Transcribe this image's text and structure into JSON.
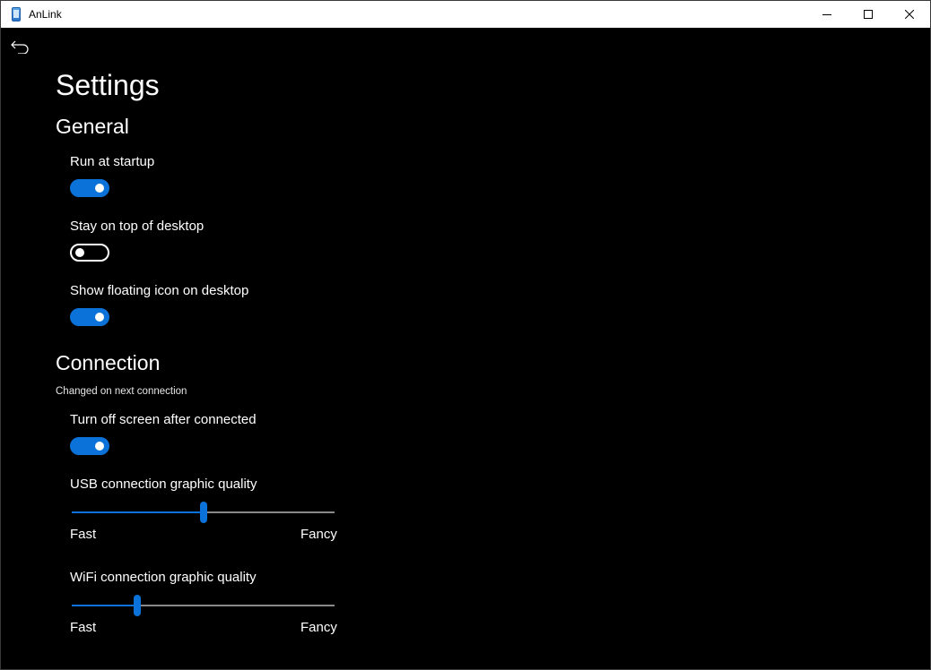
{
  "window": {
    "title": "AnLink",
    "icon": "phone-app-icon"
  },
  "page": {
    "back_icon": "back-arrow-icon",
    "title": "Settings"
  },
  "general": {
    "title": "General",
    "settings": [
      {
        "label": "Run at startup",
        "on": true
      },
      {
        "label": "Stay on top of desktop",
        "on": false
      },
      {
        "label": "Show floating icon on desktop",
        "on": true
      }
    ]
  },
  "connection": {
    "title": "Connection",
    "note": "Changed on next connection",
    "screen_off": {
      "label": "Turn off screen after connected",
      "on": true
    },
    "usb_quality": {
      "label": "USB connection graphic quality",
      "min_label": "Fast",
      "max_label": "Fancy",
      "value_percent": 50
    },
    "wifi_quality": {
      "label": "WiFi connection graphic quality",
      "min_label": "Fast",
      "max_label": "Fancy",
      "value_percent": 25
    }
  },
  "colors": {
    "accent": "#0a72d8",
    "background": "#000000",
    "titlebar": "#ffffff"
  }
}
